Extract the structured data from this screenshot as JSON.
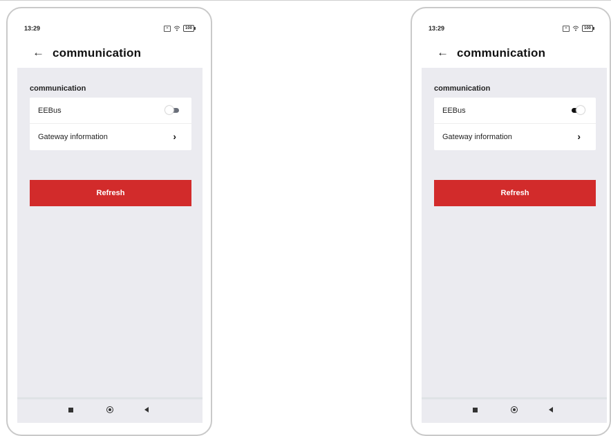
{
  "screens": [
    {
      "status": {
        "time": "13:29",
        "battery": "100"
      },
      "header": {
        "title": "communication"
      },
      "section": {
        "title": "communication",
        "items": [
          {
            "label": "EEBus",
            "type": "toggle",
            "state": "off"
          },
          {
            "label": "Gateway information",
            "type": "link"
          }
        ]
      },
      "refresh_label": "Refresh"
    },
    {
      "status": {
        "time": "13:29",
        "battery": "100"
      },
      "header": {
        "title": "communication"
      },
      "section": {
        "title": "communication",
        "items": [
          {
            "label": "EEBus",
            "type": "toggle",
            "state": "on"
          },
          {
            "label": "Gateway information",
            "type": "link"
          }
        ]
      },
      "refresh_label": "Refresh"
    }
  ],
  "colors": {
    "accent_red": "#d22b2b",
    "content_bg": "#ebebf0",
    "toggle_off_track": "#6a6f7a",
    "toggle_on_track": "#111111"
  },
  "icons": {
    "back": "arrow-left-icon",
    "chevron": "chevron-right-icon",
    "nav_recents": "square-icon",
    "nav_home": "circle-icon",
    "nav_back": "triangle-left-icon"
  }
}
